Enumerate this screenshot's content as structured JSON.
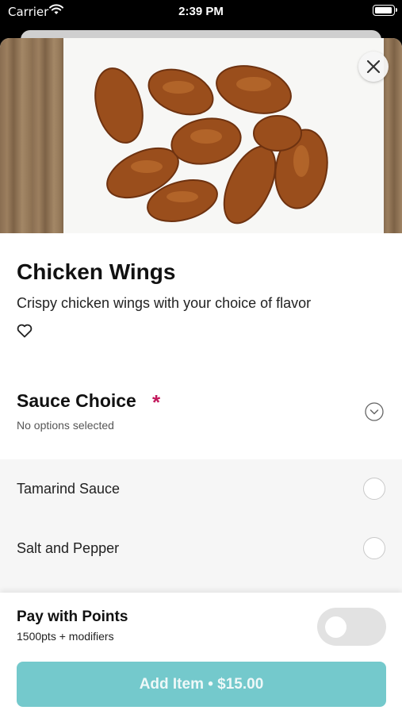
{
  "status_bar": {
    "carrier": "Carrier",
    "time": "2:39 PM"
  },
  "item": {
    "title": "Chicken Wings",
    "description": "Crispy chicken wings with your choice of flavor"
  },
  "modifier_group": {
    "title": "Sauce Choice",
    "required_marker": "*",
    "status": "No options selected",
    "options": [
      {
        "label": "Tamarind Sauce",
        "selected": false
      },
      {
        "label": "Salt and Pepper",
        "selected": false
      }
    ]
  },
  "points": {
    "title": "Pay with Points",
    "subtitle": "1500pts + modifiers",
    "enabled": false
  },
  "add_button": {
    "label": "Add Item • $15.00"
  },
  "colors": {
    "accent": "#74c9cc",
    "required": "#c2185b"
  },
  "icons": [
    "wifi-icon",
    "battery-icon",
    "close-icon",
    "heart-icon",
    "chevron-down-icon"
  ]
}
